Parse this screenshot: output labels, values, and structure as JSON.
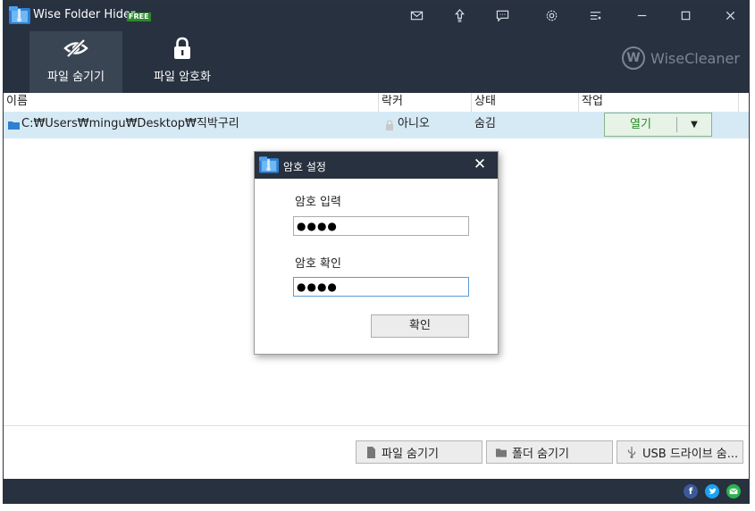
{
  "app": {
    "title": "Wise Folder Hider",
    "badge": "FREE"
  },
  "titlebar_icons": [
    "mail-icon",
    "upload-icon",
    "feedback-icon",
    "gear-icon",
    "menu-icon",
    "minimize-icon",
    "maximize-icon",
    "close-icon"
  ],
  "tabs": [
    {
      "label": "파일 숨기기",
      "icon": "eye-slash-icon",
      "active": true
    },
    {
      "label": "파일 암호화",
      "icon": "lock-icon",
      "active": false
    }
  ],
  "brand": {
    "letter": "W",
    "name": "WiseCleaner"
  },
  "table": {
    "headers": [
      "이름",
      "락커",
      "상태",
      "작업"
    ],
    "rows": [
      {
        "name": "C:₩Users₩mingu₩Desktop₩직박구리",
        "locker": "아니오",
        "status": "숨김",
        "action": "열기",
        "dropdown": "▼"
      }
    ]
  },
  "bottom_buttons": [
    "파일 숨기기",
    "폴더 숨기기",
    "USB 드라이브 숨..."
  ],
  "dialog": {
    "title": "암호 설정",
    "close": "✕",
    "password_label": "암호 입력",
    "password_value": "●●●●",
    "confirm_label": "암호 확인",
    "confirm_value": "●●●●",
    "ok_label": "확인"
  },
  "social": [
    "facebook-icon",
    "twitter-icon",
    "email-icon"
  ],
  "colors": {
    "titlebar": "#27313f",
    "row_highlight": "#d6eaf6",
    "accent_green": "#2c8c2c"
  }
}
